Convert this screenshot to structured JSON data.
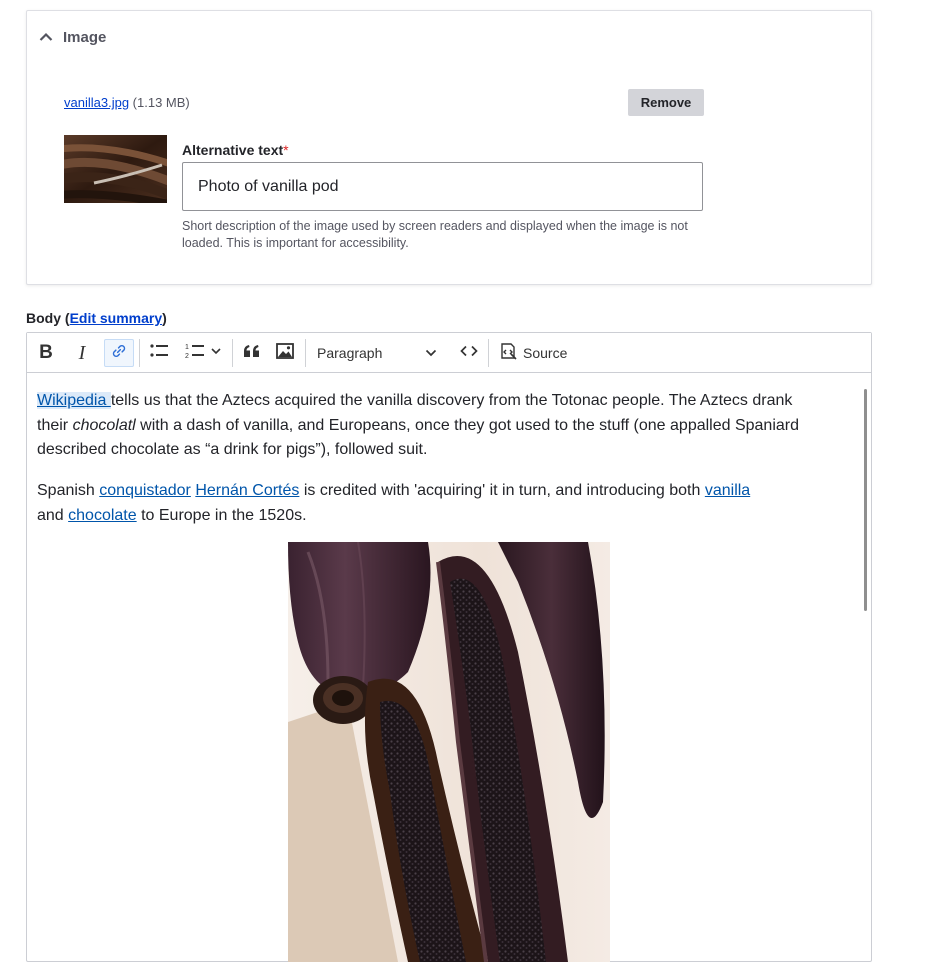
{
  "image_panel": {
    "title": "Image",
    "file_name": "vanilla3.jpg",
    "file_size": "(1.13 MB)",
    "remove_label": "Remove",
    "alt_label": "Alternative text",
    "alt_required_marker": "*",
    "alt_value": "Photo of vanilla pod",
    "alt_description": "Short description of the image used by screen readers and displayed when the image is not loaded. This is important for accessibility."
  },
  "body_field": {
    "label": "Body",
    "open_paren": " (",
    "edit_summary": "Edit summary",
    "close_paren": ")"
  },
  "toolbar": {
    "bold_label": "B",
    "italic_label": "I",
    "heading_select": "Paragraph",
    "source_label": "Source",
    "icons": [
      "bold-icon",
      "italic-icon",
      "link-icon",
      "bulleted-list-icon",
      "numbered-list-icon",
      "blockquote-icon",
      "image-icon",
      "code-icon",
      "source-icon"
    ]
  },
  "content": {
    "p1": {
      "link_wikipedia": "Wikipedia ",
      "text_a": "tells us that the Aztecs acquired the vanilla discovery from the Totonac people. The Aztecs drank their ",
      "italic_chocolatl": "chocolatl",
      "text_b": " with a dash of vanilla, and Europeans, once they got used to the stuff (one appalled Spaniard described chocolate as “a drink for pigs”), followed suit."
    },
    "p2": {
      "text_a": "Spanish ",
      "link_conquistador": "conquistador",
      "space_1": " ",
      "link_cortes": "Hernán Cortés",
      "text_b": " is credited with 'acquiring' it in turn, and introducing both ",
      "link_vanilla": "vanilla",
      "text_c": " and ",
      "link_chocolate": "chocolate",
      "text_d": " to Europe in the 1520s."
    }
  },
  "colors": {
    "link": "#0055aa",
    "panel_link": "#003ecc",
    "required": "#dc2323",
    "button_bg": "#d3d4d9"
  }
}
